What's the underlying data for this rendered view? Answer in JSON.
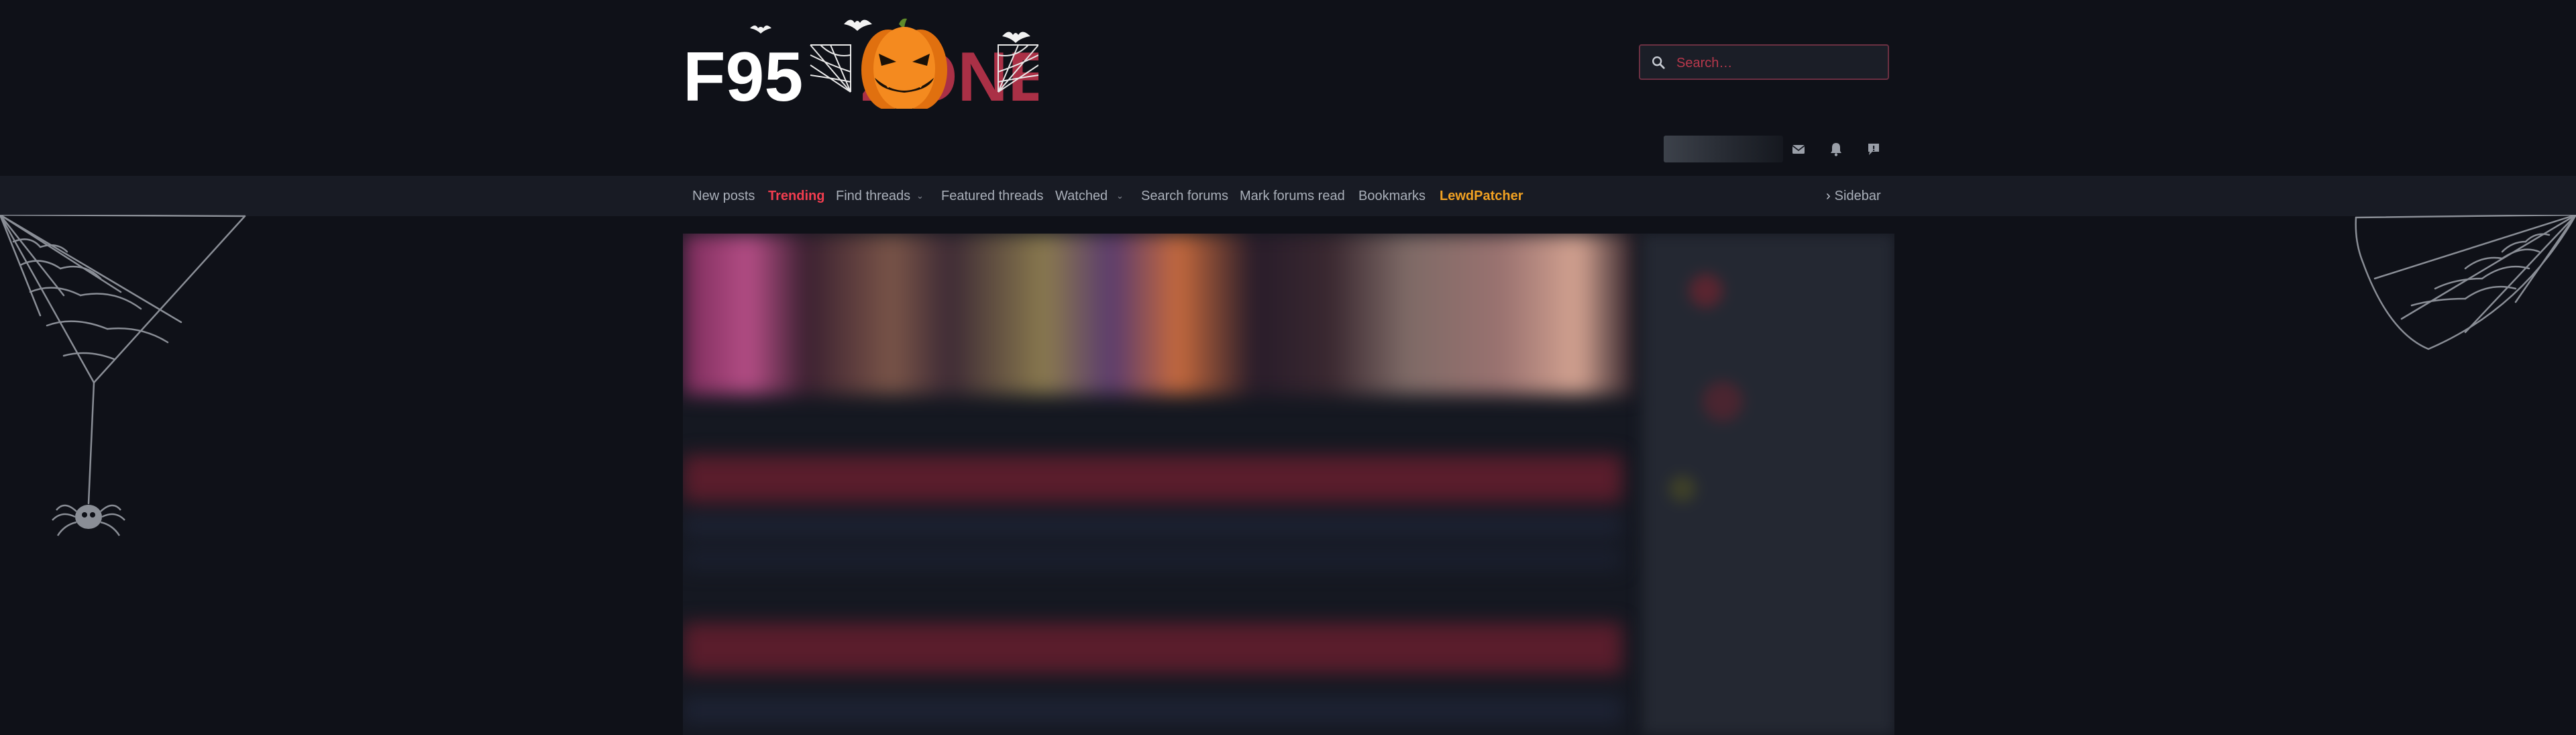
{
  "header": {
    "logo_text_left": "F95",
    "logo_text_right": "ZONE",
    "logo_alt": "F95zone Halloween logo"
  },
  "search": {
    "placeholder": "Search…",
    "icon": "search-icon"
  },
  "user_icons": [
    "envelope-icon",
    "bell-icon",
    "alert-bubble-icon"
  ],
  "nav": {
    "items": [
      {
        "label": "New posts"
      },
      {
        "label": "Trending"
      },
      {
        "label": "Find threads"
      },
      {
        "label": "Featured threads"
      },
      {
        "label": "Watched"
      },
      {
        "label": "Search forums"
      },
      {
        "label": "Mark forums read"
      },
      {
        "label": "Bookmarks"
      },
      {
        "label": "LewdPatcher"
      }
    ],
    "sidebar_label": "Sidebar"
  },
  "colors": {
    "background": "#0f1118",
    "navbar": "#181b24",
    "accent_red": "#f23d4f",
    "accent_orange": "#f2a222",
    "pumpkin": "#f07e1a"
  }
}
